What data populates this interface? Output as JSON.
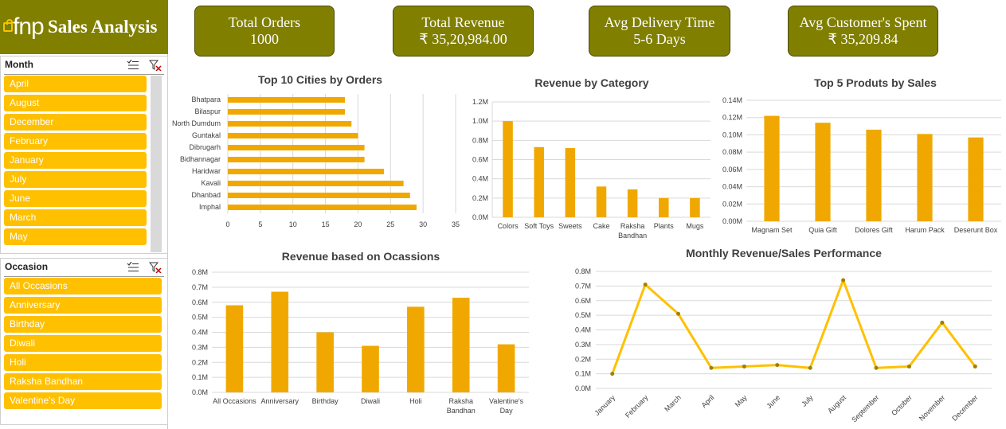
{
  "brand": {
    "logo_text": "fnp",
    "title": "Sales Analysis"
  },
  "kpis": [
    {
      "label": "Total Orders",
      "value": "1000"
    },
    {
      "label": "Total Revenue",
      "value": "₹ 35,20,984.00"
    },
    {
      "label": "Avg Delivery Time",
      "value": "5-6 Days"
    },
    {
      "label": "Avg Customer's Spent",
      "value": "₹ 35,209.84"
    }
  ],
  "month_slicer": {
    "title": "Month",
    "items": [
      "April",
      "August",
      "December",
      "February",
      "January",
      "July",
      "June",
      "March",
      "May"
    ]
  },
  "occasion_slicer": {
    "title": "Occasion",
    "items": [
      "All Occasions",
      "Anniversary",
      "Birthday",
      "Diwali",
      "Holi",
      "Raksha Bandhan",
      "Valentine's Day"
    ]
  },
  "colors": {
    "brand": "#807f00",
    "bar": "#f0a800",
    "slicer": "#ffc000",
    "line": "#ffc000",
    "line_marker": "#a08000"
  },
  "chart_data": [
    {
      "id": "cities",
      "type": "bar",
      "orientation": "horizontal",
      "title": "Top 10 Cities by Orders",
      "categories": [
        "Bhatpara",
        "Bilaspur",
        "North Dumdum",
        "Guntakal",
        "Dibrugarh",
        "Bidhannagar",
        "Haridwar",
        "Kavali",
        "Dhanbad",
        "Imphal"
      ],
      "values": [
        18,
        18,
        19,
        20,
        21,
        21,
        24,
        27,
        28,
        29
      ],
      "xlim": [
        0,
        35
      ],
      "ticks": [
        "0",
        "5",
        "10",
        "15",
        "20",
        "25",
        "30",
        "35"
      ]
    },
    {
      "id": "category",
      "type": "bar",
      "title": "Revenue by Category",
      "categories": [
        "Colors",
        "Soft Toys",
        "Sweets",
        "Cake",
        "Raksha Bandhan",
        "Plants",
        "Mugs"
      ],
      "values": [
        1.0,
        0.73,
        0.72,
        0.32,
        0.29,
        0.2,
        0.2
      ],
      "ylim": [
        0,
        1.2
      ],
      "ticks": [
        "0.0M",
        "0.2M",
        "0.4M",
        "0.6M",
        "0.8M",
        "1.0M",
        "1.2M"
      ]
    },
    {
      "id": "products",
      "type": "bar",
      "title": "Top 5 Produts by Sales",
      "categories": [
        "Magnam Set",
        "Quia Gift",
        "Dolores Gift",
        "Harum Pack",
        "Deserunt Box"
      ],
      "values": [
        0.122,
        0.114,
        0.106,
        0.101,
        0.097
      ],
      "ylim": [
        0,
        0.14
      ],
      "ticks": [
        "0.00M",
        "0.02M",
        "0.04M",
        "0.06M",
        "0.08M",
        "0.10M",
        "0.12M",
        "0.14M"
      ]
    },
    {
      "id": "occasions",
      "type": "bar",
      "title": "Revenue based on Ocassions",
      "categories": [
        "All Occasions",
        "Anniversary",
        "Birthday",
        "Diwali",
        "Holi",
        "Raksha Bandhan",
        "Valentine's Day"
      ],
      "values": [
        0.58,
        0.67,
        0.4,
        0.31,
        0.57,
        0.63,
        0.32
      ],
      "ylim": [
        0,
        0.8
      ],
      "ticks": [
        "0.0M",
        "0.1M",
        "0.2M",
        "0.3M",
        "0.4M",
        "0.5M",
        "0.6M",
        "0.7M",
        "0.8M"
      ]
    },
    {
      "id": "monthly",
      "type": "line",
      "title": "Monthly Revenue/Sales Performance",
      "categories": [
        "January",
        "February",
        "March",
        "April",
        "May",
        "June",
        "July",
        "August",
        "September",
        "October",
        "November",
        "December"
      ],
      "values": [
        0.1,
        0.71,
        0.51,
        0.14,
        0.15,
        0.16,
        0.14,
        0.74,
        0.14,
        0.15,
        0.45,
        0.15
      ],
      "ylim": [
        0,
        0.8
      ],
      "ticks": [
        "0.0M",
        "0.1M",
        "0.2M",
        "0.3M",
        "0.4M",
        "0.5M",
        "0.6M",
        "0.7M",
        "0.8M"
      ]
    }
  ]
}
